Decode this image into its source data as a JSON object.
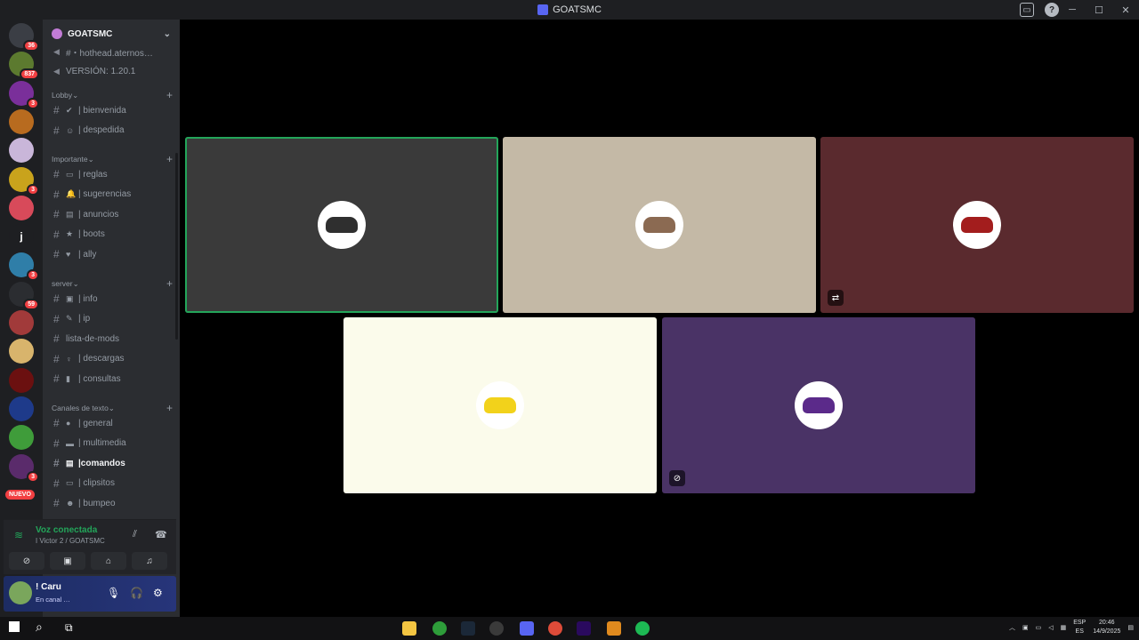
{
  "window": {
    "title": "GOATSMC"
  },
  "server": {
    "name": "GOATSMC"
  },
  "guilds": [
    {
      "badge": "36",
      "color": "#3b3e45"
    },
    {
      "badge": "837",
      "color": "#5c7a2f"
    },
    {
      "badge": "3",
      "color": "#7a2f9a"
    },
    {
      "badge": "",
      "color": "#b86b1f"
    },
    {
      "badge": "",
      "color": "#c9b6d9"
    },
    {
      "badge": "3",
      "color": "#c9a31c"
    },
    {
      "badge": "",
      "color": "#d84a5a"
    },
    {
      "badge": "",
      "color": "#1e1f22",
      "letter": "j"
    },
    {
      "badge": "3",
      "color": "#2f7ea8"
    },
    {
      "badge": "59",
      "color": "#2b2d31"
    },
    {
      "badge": "",
      "color": "#a13a3a"
    },
    {
      "badge": "",
      "color": "#d8b46c"
    },
    {
      "badge": "",
      "color": "#6b1010"
    },
    {
      "badge": "",
      "color": "#1e3a8a"
    },
    {
      "badge": "",
      "color": "#3f9c3a"
    },
    {
      "badge": "3",
      "color": "#5a2b6b"
    }
  ],
  "guild_new_label": "NUEVO",
  "channels": {
    "top": [
      {
        "name": "#・hothead.aternos…",
        "emoji": ""
      },
      {
        "name": "VERSIÓN: 1.20.1",
        "emoji": ""
      }
    ],
    "categories": [
      {
        "name": "Lobby",
        "items": [
          {
            "label": "| bienvenida",
            "emoji": "✔"
          },
          {
            "label": "| despedida",
            "emoji": "☺"
          }
        ]
      },
      {
        "name": "Importante",
        "items": [
          {
            "label": "| reglas",
            "emoji": "▭"
          },
          {
            "label": "| sugerencias",
            "emoji": "🔔"
          },
          {
            "label": "| anuncios",
            "emoji": "▤"
          },
          {
            "label": "| boots",
            "emoji": "★"
          },
          {
            "label": "| ally",
            "emoji": "♥"
          }
        ]
      },
      {
        "name": "server",
        "items": [
          {
            "label": "| info",
            "emoji": "▣"
          },
          {
            "label": "| ip",
            "emoji": "✎"
          },
          {
            "label": "lista-de-mods",
            "emoji": ""
          },
          {
            "label": "| descargas",
            "emoji": "♀"
          },
          {
            "label": "| consultas",
            "emoji": "▮"
          }
        ]
      },
      {
        "name": "Canales de texto",
        "items": [
          {
            "label": "| general",
            "emoji": "●"
          },
          {
            "label": "| multimedia",
            "emoji": "▬"
          },
          {
            "label": "|comandos",
            "emoji": "▤"
          },
          {
            "label": "| clipsitos",
            "emoji": "▭"
          },
          {
            "label": "| bumpeo",
            "emoji": "☻"
          }
        ]
      }
    ]
  },
  "voice": {
    "status": "Voz conectada",
    "channel": "Victor 2 / GOATSMC"
  },
  "user": {
    "name": "! Caru",
    "status": "En canal …"
  },
  "tiles": [
    {
      "bg": "#3a3a3a",
      "speaking": true,
      "avatar_color": "#2f2f2f"
    },
    {
      "bg": "#c4b9a6",
      "speaking": false,
      "avatar_color": "#8b6a52"
    },
    {
      "bg": "#5a2a2e",
      "speaking": false,
      "avatar_color": "#a31d1d"
    },
    {
      "bg": "#fbfbeb",
      "speaking": false,
      "avatar_color": "#f2d21b"
    },
    {
      "bg": "#4a3366",
      "speaking": false,
      "avatar_color": "#5b2a8a"
    }
  ],
  "taskbar": {
    "lang_top": "ESP",
    "lang_bottom": "ES",
    "time": "20:46",
    "date": "14/9/2025"
  }
}
